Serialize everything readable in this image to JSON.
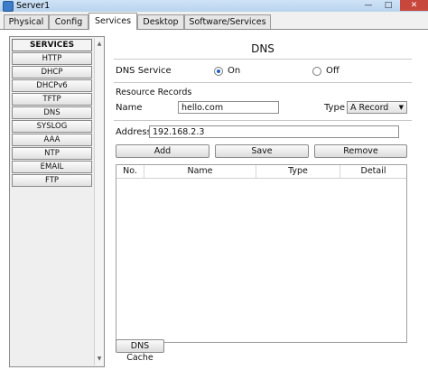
{
  "window": {
    "title": "Server1"
  },
  "tabs": [
    {
      "label": "Physical"
    },
    {
      "label": "Config"
    },
    {
      "label": "Services"
    },
    {
      "label": "Desktop"
    },
    {
      "label": "Software/Services"
    }
  ],
  "sidebar": {
    "title": "SERVICES",
    "items": [
      {
        "label": "HTTP"
      },
      {
        "label": "DHCP"
      },
      {
        "label": "DHCPv6"
      },
      {
        "label": "TFTP"
      },
      {
        "label": "DNS"
      },
      {
        "label": "SYSLOG"
      },
      {
        "label": "AAA"
      },
      {
        "label": "NTP"
      },
      {
        "label": "EMAIL"
      },
      {
        "label": "FTP"
      }
    ]
  },
  "dns": {
    "heading": "DNS",
    "service_label": "DNS Service",
    "on_label": "On",
    "off_label": "Off",
    "service_state": "on",
    "records_label": "Resource Records",
    "name_label": "Name",
    "name_value": "hello.com",
    "type_label": "Type",
    "type_value": "A Record",
    "address_label": "Address",
    "address_value": "192.168.2.3",
    "add_label": "Add",
    "save_label": "Save",
    "remove_label": "Remove",
    "columns": [
      "No.",
      "Name",
      "Type",
      "Detail"
    ],
    "cache_label": "DNS Cache"
  }
}
